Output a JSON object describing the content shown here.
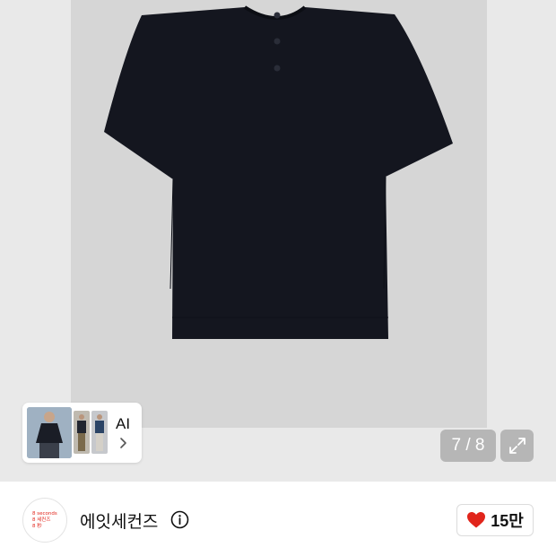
{
  "gallery": {
    "counter": "7 / 8",
    "ai_label": "AI"
  },
  "brand": {
    "name": "에잇세컨즈",
    "logo_lines": [
      "8 seconds",
      "8 세컨즈",
      "8 秒"
    ],
    "like_count": "15만"
  },
  "colors": {
    "accent_red": "#e1251b",
    "product": "#14161f"
  },
  "icons": {
    "chevron": "chevron-right-icon",
    "expand": "expand-icon",
    "info": "info-icon",
    "heart": "heart-icon"
  }
}
